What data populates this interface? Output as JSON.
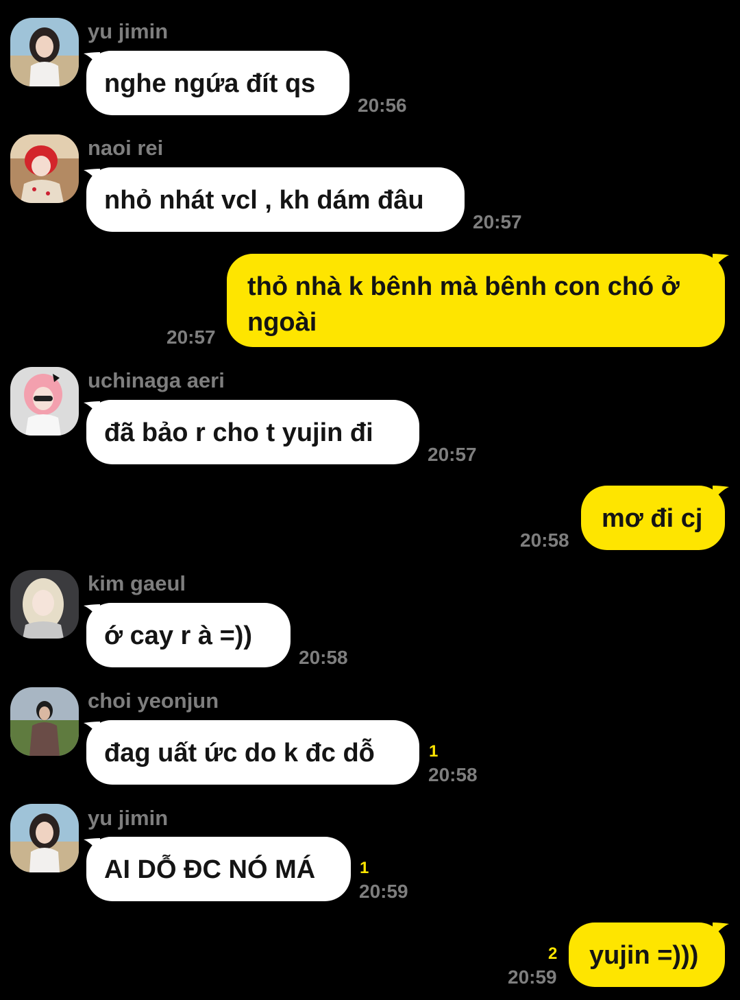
{
  "chat": {
    "messages": [
      {
        "sender": "yu jimin",
        "text": "nghe ngứa đít qs",
        "time": "20:56"
      },
      {
        "sender": "naoi rei",
        "text": "nhỏ nhát vcl , kh dám đâu",
        "time": "20:57"
      },
      {
        "sender": "me",
        "text": "thỏ nhà k bênh mà bênh con chó ở ngoài",
        "time": "20:57"
      },
      {
        "sender": "uchinaga aeri",
        "text": "đã bảo r cho t yujin đi",
        "time": "20:57"
      },
      {
        "sender": "me",
        "text": "mơ đi cj",
        "time": "20:58"
      },
      {
        "sender": "kim gaeul",
        "text": "ớ cay r à =))",
        "time": "20:58"
      },
      {
        "sender": "choi yeonjun",
        "text": "đag uất ức do k đc dỗ",
        "time": "20:58",
        "unread": "1"
      },
      {
        "sender": "yu jimin",
        "text": "AI DỖ ĐC NÓ MÁ",
        "time": "20:59",
        "unread": "1"
      },
      {
        "sender": "me",
        "text": "yujin =)))",
        "time": "20:59",
        "unread": "2"
      }
    ]
  },
  "colors": {
    "background": "#000000",
    "incoming_bubble": "#ffffff",
    "outgoing_bubble": "#fee500",
    "meta_text": "#7e7e7e",
    "unread_count": "#fee500"
  },
  "icons": {
    "avatar": "user-photo-avatar"
  }
}
